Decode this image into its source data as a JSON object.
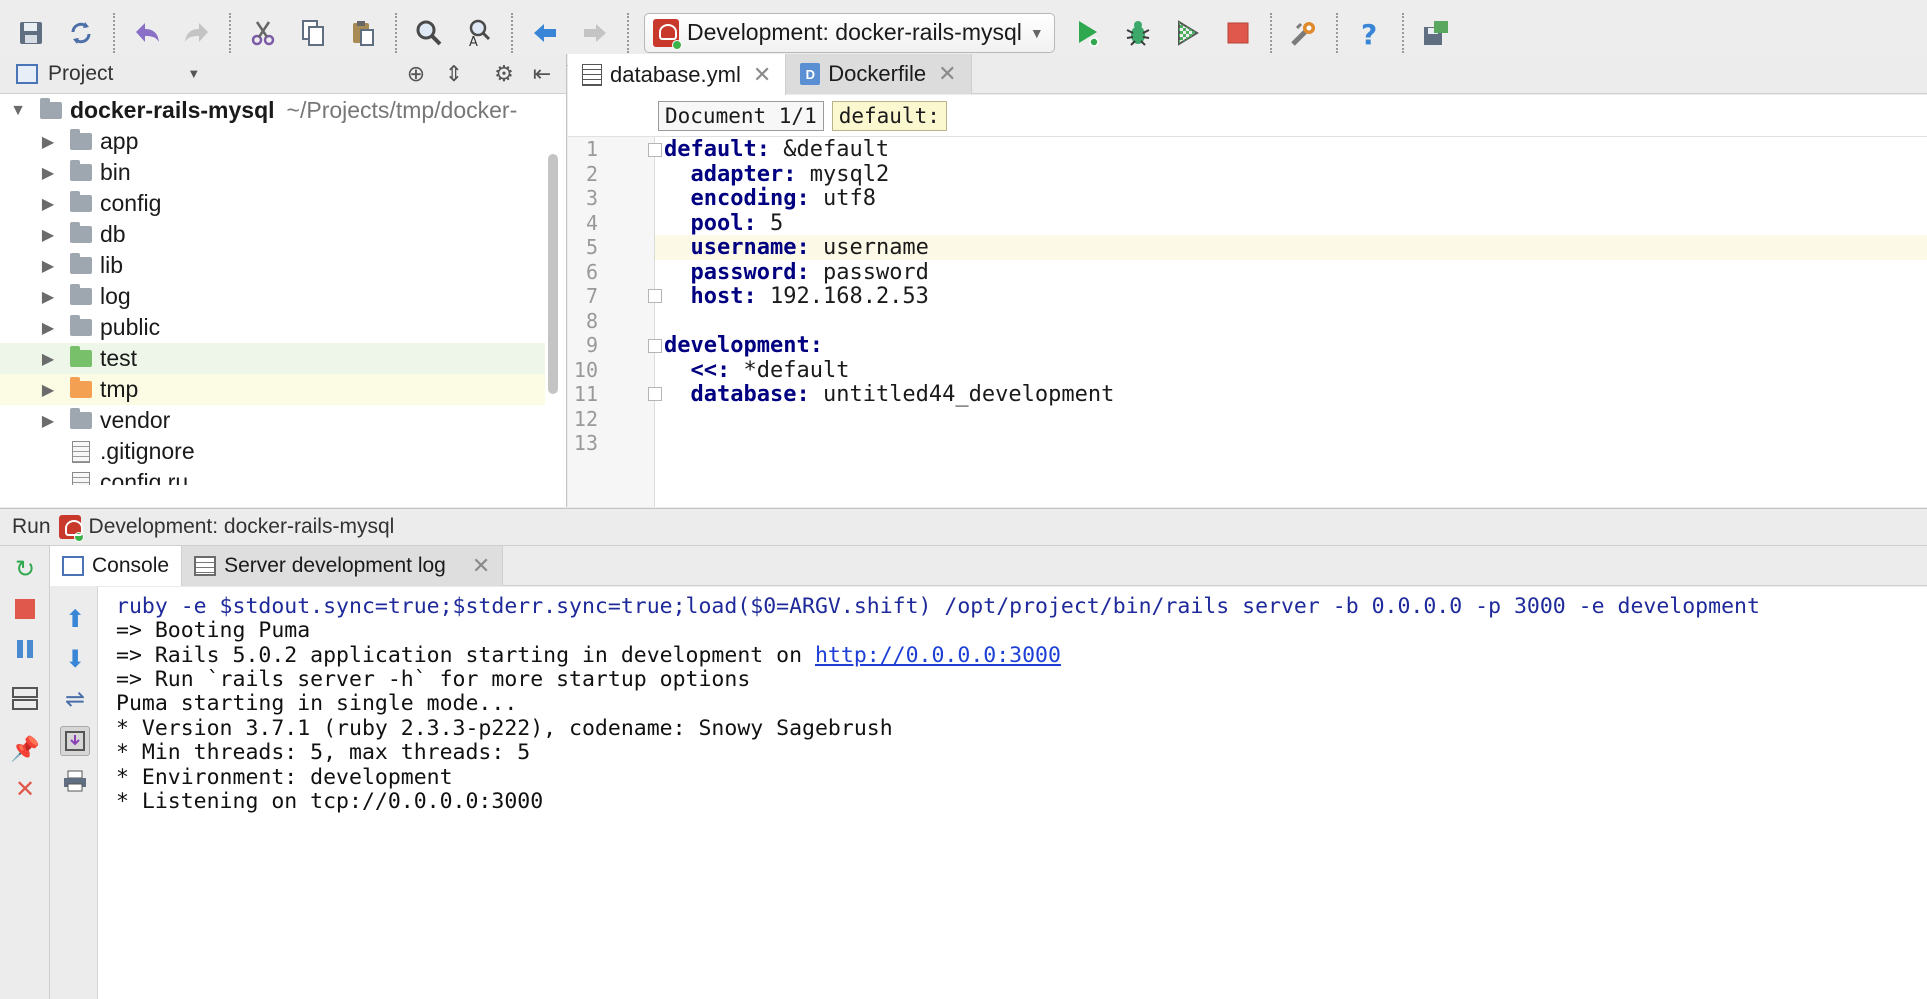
{
  "toolbar": {
    "run_config": "Development: docker-rails-mysql",
    "icons": [
      "save-icon",
      "sync-icon",
      "undo-icon",
      "redo-icon",
      "cut-icon",
      "copy-icon",
      "paste-icon",
      "find-icon",
      "replace-icon",
      "back-icon",
      "forward-icon",
      "run-icon",
      "debug-icon",
      "coverage-icon",
      "stop-icon",
      "settings-icon",
      "help-icon",
      "sdk-icon"
    ],
    "colors": {
      "run": "#2fa84f",
      "stop": "#e0584b",
      "undo": "#8a6fc7",
      "nav": "#3a86d6"
    }
  },
  "project": {
    "title": "Project",
    "root": {
      "name": "docker-rails-mysql",
      "path": "~/Projects/tmp/docker-"
    },
    "items": [
      {
        "name": "app",
        "type": "folder"
      },
      {
        "name": "bin",
        "type": "folder"
      },
      {
        "name": "config",
        "type": "folder"
      },
      {
        "name": "db",
        "type": "folder"
      },
      {
        "name": "lib",
        "type": "folder"
      },
      {
        "name": "log",
        "type": "folder"
      },
      {
        "name": "public",
        "type": "folder"
      },
      {
        "name": "test",
        "type": "folder-test"
      },
      {
        "name": "tmp",
        "type": "folder-excluded"
      },
      {
        "name": "vendor",
        "type": "folder"
      },
      {
        "name": ".gitignore",
        "type": "file"
      },
      {
        "name": "config.ru",
        "type": "file"
      }
    ]
  },
  "editor": {
    "tabs": [
      {
        "label": "database.yml",
        "active": true
      },
      {
        "label": "Dockerfile",
        "active": false
      }
    ],
    "breadcrumbs": [
      "Document 1/1",
      "default:"
    ],
    "current_line": 5,
    "lines": [
      {
        "n": "1",
        "key": "default:",
        "value": " &default",
        "indent": ""
      },
      {
        "n": "2",
        "key": "adapter:",
        "value": " mysql2",
        "indent": "  "
      },
      {
        "n": "3",
        "key": "encoding:",
        "value": " utf8",
        "indent": "  "
      },
      {
        "n": "4",
        "key": "pool:",
        "value": " 5",
        "indent": "  "
      },
      {
        "n": "5",
        "key": "username:",
        "value": " username",
        "indent": "  "
      },
      {
        "n": "6",
        "key": "password:",
        "value": " password",
        "indent": "  "
      },
      {
        "n": "7",
        "key": "host:",
        "value": " 192.168.2.53",
        "indent": "  "
      },
      {
        "n": "8",
        "key": "",
        "value": "",
        "indent": ""
      },
      {
        "n": "9",
        "key": "development:",
        "value": "",
        "indent": ""
      },
      {
        "n": "10",
        "key": "<<:",
        "value": " *default",
        "indent": "  "
      },
      {
        "n": "11",
        "key": "database:",
        "value": " untitled44_development",
        "indent": "  "
      },
      {
        "n": "12",
        "key": "",
        "value": "",
        "indent": ""
      },
      {
        "n": "13",
        "key": "",
        "value": "",
        "indent": ""
      }
    ]
  },
  "run": {
    "label": "Run",
    "config": "Development: docker-rails-mysql",
    "tabs": [
      {
        "label": "Console",
        "active": true
      },
      {
        "label": "Server development log",
        "active": false
      }
    ],
    "console": {
      "command": "ruby -e $stdout.sync=true;$stderr.sync=true;load($0=ARGV.shift) /opt/project/bin/rails server -b 0.0.0.0 -p 3000 -e development",
      "line1": "=> Booting Puma",
      "line2_prefix": "=> Rails 5.0.2 application starting in development on ",
      "line2_link": "http://0.0.0.0:3000",
      "line3": "=> Run `rails server -h` for more startup options",
      "line4": "Puma starting in single mode...",
      "line5": "* Version 3.7.1 (ruby 2.3.3-p222), codename: Snowy Sagebrush",
      "line6": "* Min threads: 5, max threads: 5",
      "line7": "* Environment: development",
      "line8": "* Listening on tcp://0.0.0.0:3000"
    }
  }
}
